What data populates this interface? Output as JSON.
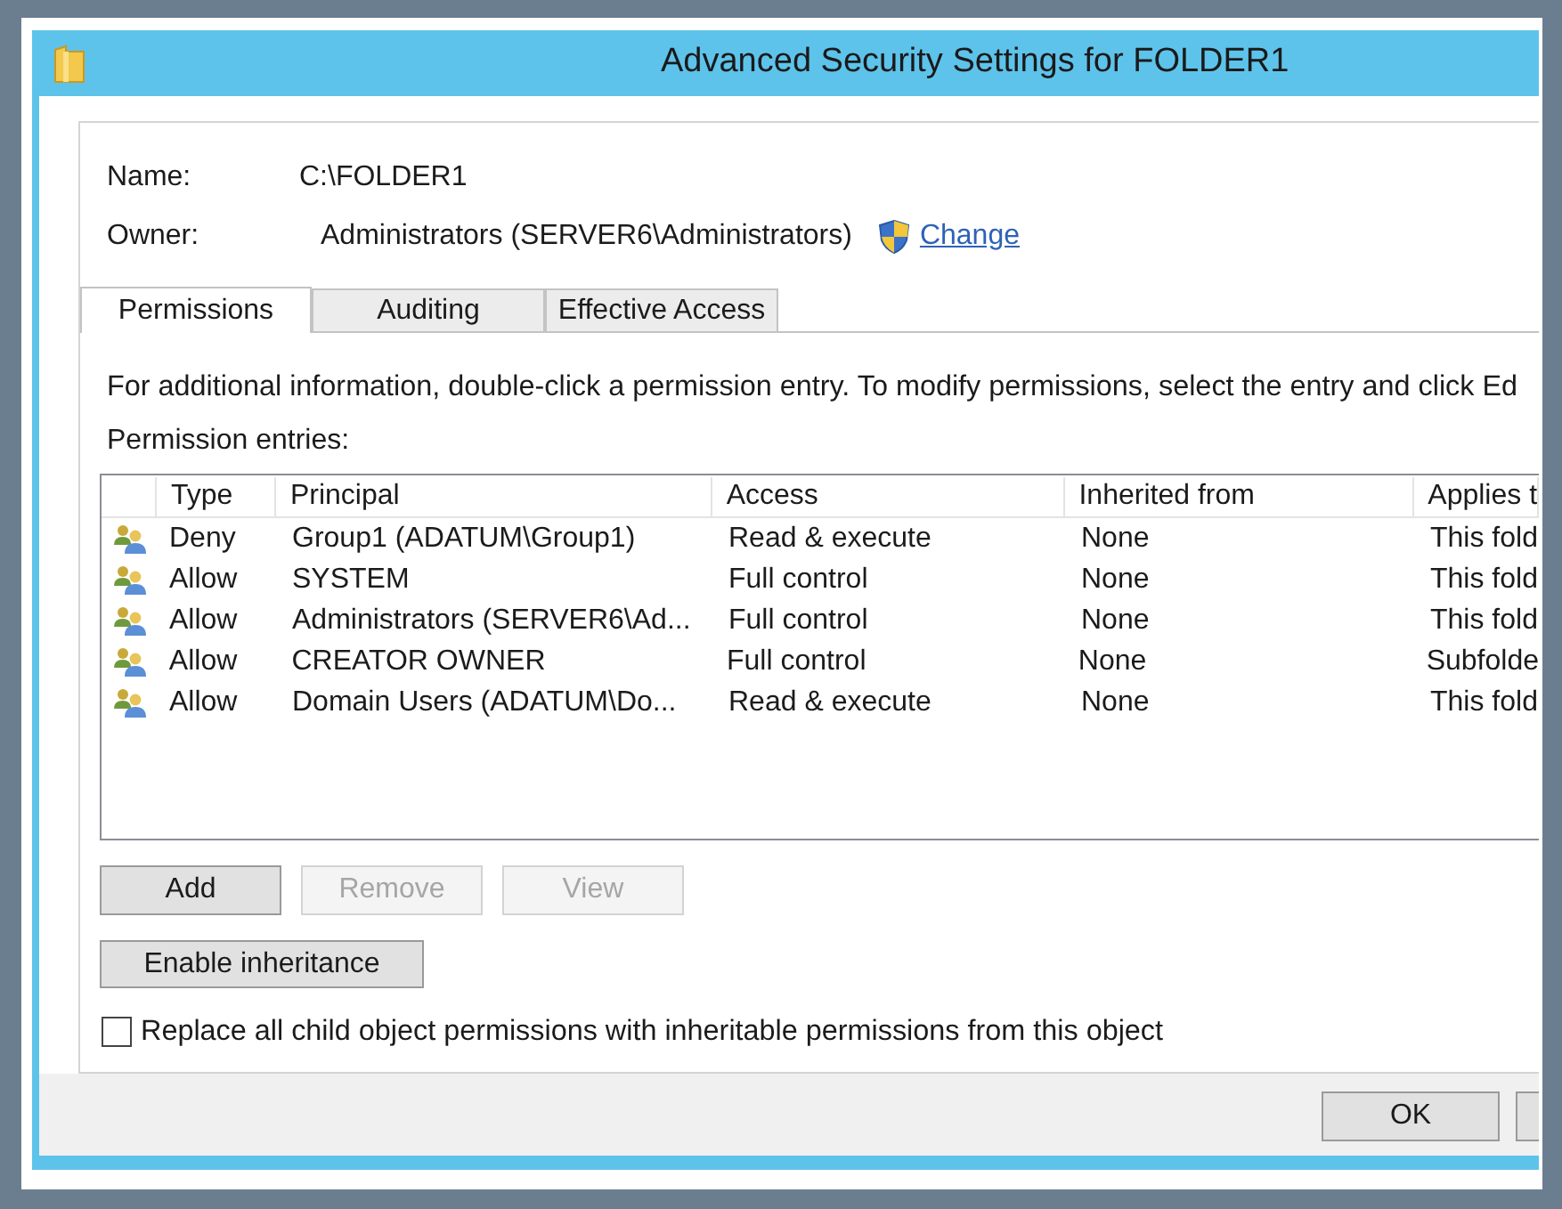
{
  "window": {
    "title": "Advanced Security Settings for FOLDER1"
  },
  "name": {
    "label": "Name:",
    "value": "C:\\FOLDER1"
  },
  "owner": {
    "label": "Owner:",
    "value": "Administrators (SERVER6\\Administrators)",
    "link": "Change"
  },
  "tabs": [
    {
      "label": "Permissions",
      "selected": true
    },
    {
      "label": "Auditing",
      "selected": false
    },
    {
      "label": "Effective Access",
      "selected": false
    }
  ],
  "instructions": "For additional information, double-click a permission entry. To modify permissions, select the entry and click Ed",
  "permission_entries": {
    "label": "Permission entries:",
    "columns": [
      "Type",
      "Principal",
      "Access",
      "Inherited from",
      "Applies t"
    ],
    "rows": [
      {
        "type": "Deny",
        "principal": "Group1 (ADATUM\\Group1)",
        "access": "Read & execute",
        "inherited_from": "None",
        "column_5": "This fold"
      },
      {
        "type": "Allow",
        "principal": "SYSTEM",
        "access": "Full control",
        "inherited_from": "None",
        "column_5": "This fold"
      },
      {
        "type": "Allow",
        "principal": "Administrators (SERVER6\\Ad...",
        "access": "Full control",
        "inherited_from": "None",
        "column_5": "This fold"
      },
      {
        "type": "Allow",
        "principal": "CREATOR OWNER",
        "access": "Full control",
        "inherited_from": "None",
        "column_5": "Subfolde"
      },
      {
        "type": "Allow",
        "principal": "Domain Users (ADATUM\\Do...",
        "access": "Read & execute",
        "inherited_from": "None",
        "column_5": "This fold"
      }
    ]
  },
  "entry_buttons": [
    {
      "label": "Add",
      "disabled": false
    },
    {
      "label": "Remove",
      "disabled": true
    },
    {
      "label": "View",
      "disabled": true
    }
  ],
  "inheritance_button": {
    "label": "Enable inheritance"
  },
  "replace_checkbox": {
    "label": "Replace all child object permissions with inheritable permissions from this object",
    "checked": false
  },
  "footer_buttons": [
    {
      "label": "OK"
    }
  ]
}
